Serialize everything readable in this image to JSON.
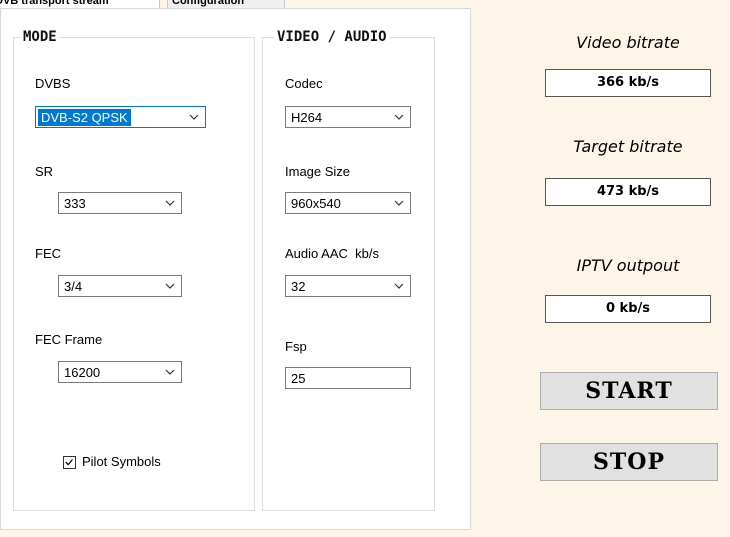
{
  "tabs": [
    {
      "label": "DVB transport stream"
    },
    {
      "label": "Configuration"
    }
  ],
  "mode": {
    "title": "MODE",
    "dvbs": {
      "label": "DVBS",
      "value": "DVB-S2 QPSK"
    },
    "sr": {
      "label": "SR",
      "value": "333"
    },
    "fec": {
      "label": "FEC",
      "value": "3/4"
    },
    "fec_frame": {
      "label": "FEC Frame",
      "value": "16200"
    },
    "pilot": {
      "label": "Pilot Symbols",
      "checked": true
    }
  },
  "video_audio": {
    "title": "VIDEO / AUDIO",
    "codec": {
      "label": "Codec",
      "value": "H264"
    },
    "image_size": {
      "label": "Image Size",
      "value": "960x540"
    },
    "audio": {
      "label": "Audio AAC  kb/s",
      "value": "32"
    },
    "fsp": {
      "label": "Fsp",
      "value": "25"
    }
  },
  "status": {
    "video_bitrate": {
      "label": "Video bitrate",
      "value": "366 kb/s"
    },
    "target_bitrate": {
      "label": "Target bitrate",
      "value": "473 kb/s"
    },
    "iptv_output": {
      "label": "IPTV outpout",
      "value": "0 kb/s"
    }
  },
  "buttons": {
    "start": "START",
    "stop": "STOP"
  }
}
